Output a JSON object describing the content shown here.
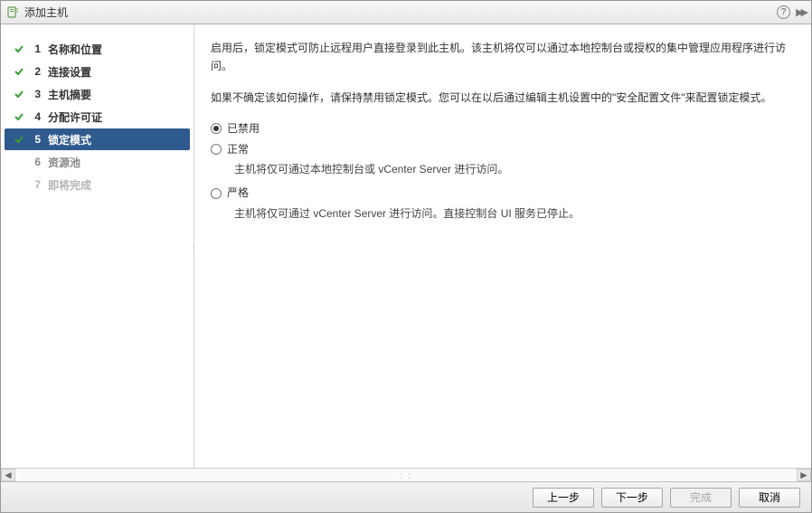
{
  "window": {
    "title": "添加主机"
  },
  "sidebar": {
    "steps": [
      {
        "num": "1",
        "label": "名称和位置"
      },
      {
        "num": "2",
        "label": "连接设置"
      },
      {
        "num": "3",
        "label": "主机摘要"
      },
      {
        "num": "4",
        "label": "分配许可证"
      },
      {
        "num": "5",
        "label": "锁定模式"
      },
      {
        "num": "6",
        "label": "资源池"
      },
      {
        "num": "7",
        "label": "即将完成"
      }
    ]
  },
  "content": {
    "para1": "启用后，锁定模式可防止远程用户直接登录到此主机。该主机将仅可以通过本地控制台或授权的集中管理应用程序进行访问。",
    "para2": "如果不确定该如何操作，请保持禁用锁定模式。您可以在以后通过编辑主机设置中的\"安全配置文件\"来配置锁定模式。",
    "options": [
      {
        "label": "已禁用",
        "desc": "",
        "selected": true
      },
      {
        "label": "正常",
        "desc": "主机将仅可通过本地控制台或 vCenter Server 进行访问。",
        "selected": false
      },
      {
        "label": "严格",
        "desc": "主机将仅可通过 vCenter Server 进行访问。直接控制台 UI 服务已停止。",
        "selected": false
      }
    ]
  },
  "footer": {
    "back": "上一步",
    "next": "下一步",
    "finish": "完成",
    "cancel": "取消"
  }
}
